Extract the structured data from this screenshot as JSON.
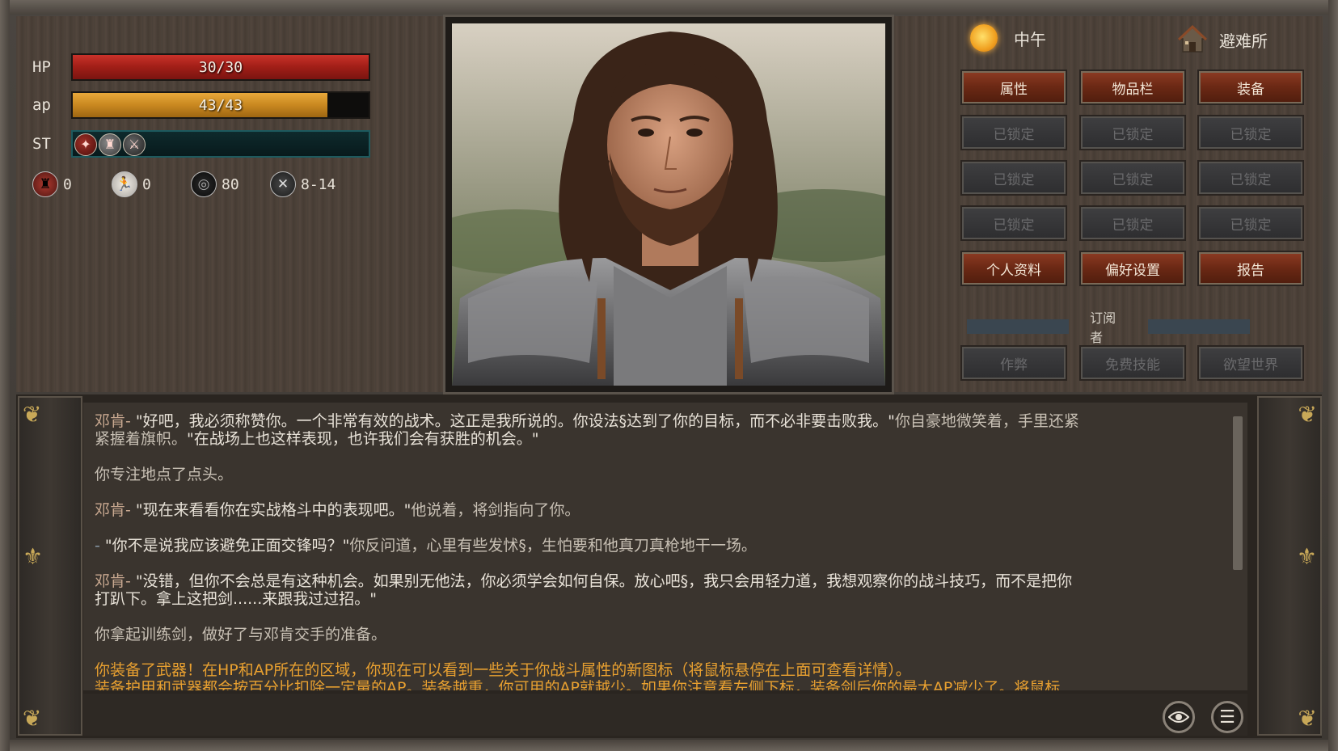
{
  "stats": {
    "hp": {
      "label": "HP",
      "text": "30/30",
      "fraction": 1.0
    },
    "ap": {
      "label": "ap",
      "text": "43/43",
      "fraction": 0.86
    },
    "st": {
      "label": "ST",
      "icon_count": 3
    }
  },
  "mini_stats": [
    {
      "icon": "armor-icon",
      "value": "0"
    },
    {
      "icon": "agility-icon",
      "value": "0"
    },
    {
      "icon": "globe-icon",
      "value": "80"
    },
    {
      "icon": "swords-icon",
      "value": "8-14"
    }
  ],
  "header": {
    "time_of_day": "中午",
    "location": "避难所"
  },
  "menu": {
    "attributes": "属性",
    "inventory": "物品栏",
    "equipment": "装备",
    "locked": "已锁定",
    "profile": "个人资料",
    "preferences": "偏好设置",
    "report": "报告",
    "subscriber": "订阅者",
    "cheat": "作弊",
    "free_skills": "免费技能",
    "desire_world": "欲望世界"
  },
  "dialogue": {
    "p1_speaker": "邓肯-",
    "p1_text": "\"好吧，我必须称赞你。一个非常有效的战术。这正是我所说的。你设法§达到了你的目标，而不必非要击败我。\"",
    "p1_narr": "你自豪地微笑着，手里还紧",
    "p1_line2_narr": "紧握着旗帜。",
    "p1_line2_text": "\"在战场上也这样表现，也许我们会有获胜的机会。\"",
    "p2": "你专注地点了点头。",
    "p3_speaker": "邓肯-",
    "p3_text": "\"现在来看看你在实战格斗中的表现吧。\"",
    "p3_narr": "他说着，将剑指向了你。",
    "p4_dash": "-",
    "p4_text": "\"你不是说我应该避免正面交锋吗？\"",
    "p4_narr": "你反问道，心里有些发怵§，生怕要和他真刀真枪地干一场。",
    "p5_speaker": "邓肯-",
    "p5_text": "\"没错，但你不会总是有这种机会。如果别无他法，你必须学会如何自保。放心吧§，我只会用轻力道，我想观察你的战斗技巧，而不是把你",
    "p5_line2": "打趴下。拿上这把剑......来跟我过过招。\"",
    "p6": "你拿起训练剑，做好了与邓肯交手的准备。",
    "p7": "你装备了武器！在HP和AP所在的区域，你现在可以看到一些关于你战斗属性的新图标（将鼠标悬停在上面可查看详情）。",
    "p8": "装备护甲和武器都会按百分比扣除一定量的AP。装备越重，你可用的AP就越少。如果你注意看左侧下标，装备剑后你的最大AP减少了。将鼠标"
  },
  "icons": {
    "eye": "eye-icon",
    "menu": "menu-icon"
  },
  "colors": {
    "hp": "#b8261e",
    "ap": "#d8961e",
    "st": "#0e2a2c",
    "button_active": "#6a2814",
    "highlight_text": "#e8a030"
  }
}
